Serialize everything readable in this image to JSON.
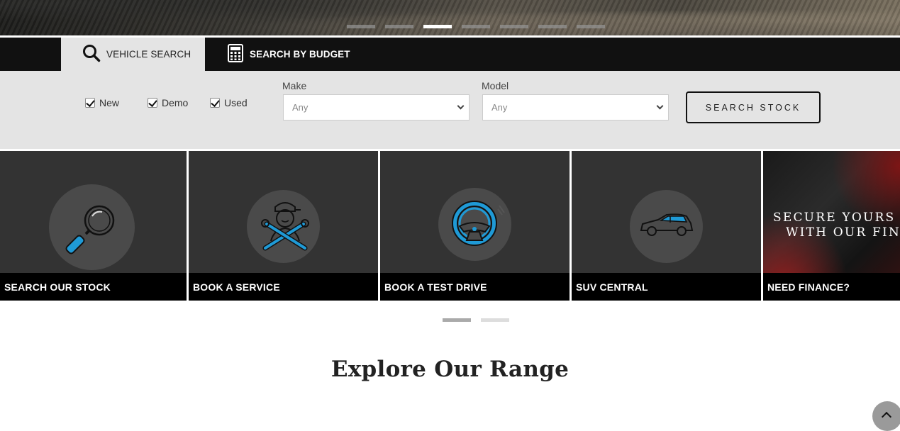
{
  "hero": {
    "slide_count": 7,
    "active_slide": 3
  },
  "tabs": [
    {
      "label": "VEHICLE SEARCH",
      "icon": "search-icon",
      "active": true
    },
    {
      "label": "SEARCH BY BUDGET",
      "icon": "calculator-icon",
      "active": false
    }
  ],
  "search": {
    "conditions": [
      {
        "label": "New",
        "checked": true
      },
      {
        "label": "Demo",
        "checked": true
      },
      {
        "label": "Used",
        "checked": true
      }
    ],
    "make": {
      "label": "Make",
      "value": "Any"
    },
    "model": {
      "label": "Model",
      "value": "Any"
    },
    "button_label": "SEARCH STOCK"
  },
  "cards": [
    {
      "label": "SEARCH OUR STOCK",
      "icon": "magnifier-icon"
    },
    {
      "label": "BOOK A SERVICE",
      "icon": "mechanic-icon"
    },
    {
      "label": "BOOK A TEST DRIVE",
      "icon": "steering-wheel-icon"
    },
    {
      "label": "SUV CENTRAL",
      "icon": "suv-icon"
    },
    {
      "label": "NEED FINANCE?",
      "image_text_1": "SECURE YOURS T",
      "image_text_2": "WITH OUR FINA"
    }
  ],
  "carousel": {
    "page_count": 2,
    "active_page": 1
  },
  "section_title": "Explore Our Range",
  "colors": {
    "accent": "#1f9ad6",
    "dark": "#111111",
    "panel": "#e4e4e4"
  }
}
